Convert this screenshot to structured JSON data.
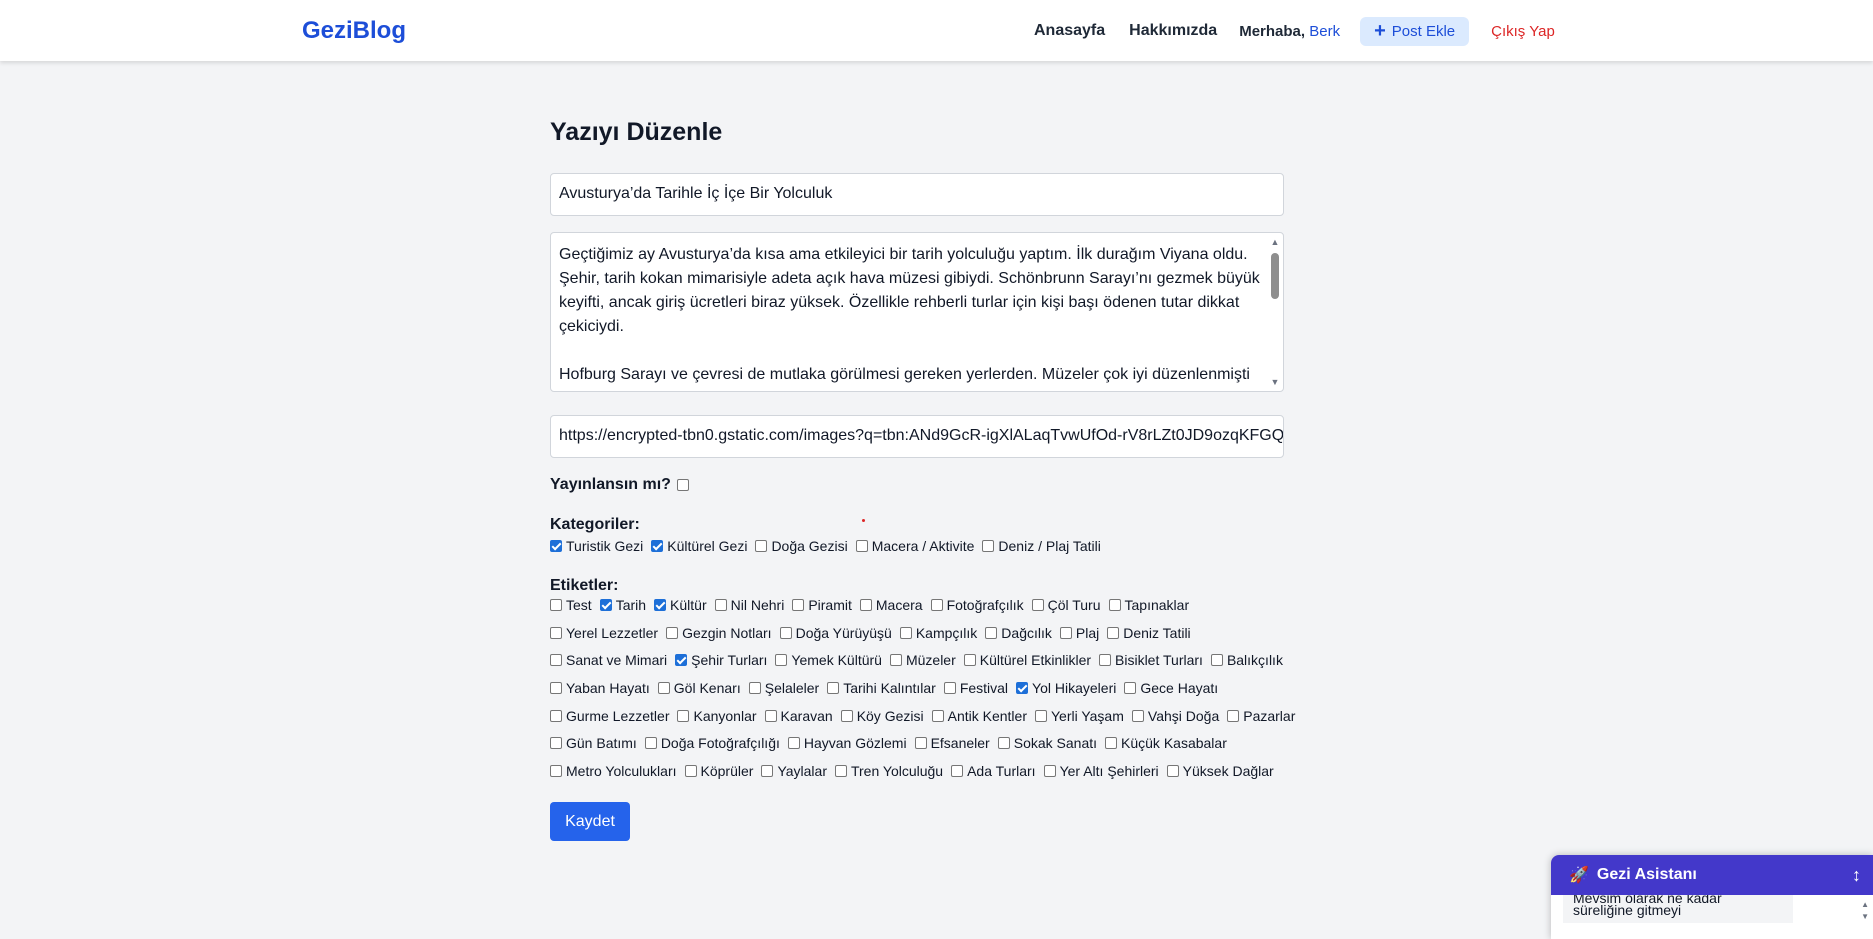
{
  "navbar": {
    "logo": "GeziBlog",
    "links": {
      "home": "Anasayfa",
      "about": "Hakkımızda"
    },
    "greeting": "Merhaba,",
    "username": "Berk",
    "add_post_icon": "plus-icon",
    "add_post": "Post Ekle",
    "logout": "Çıkış Yap",
    "colors": {
      "brand": "#1d4ed8",
      "logout": "#dc2626"
    }
  },
  "form": {
    "heading": "Yazıyı Düzenle",
    "title_value": "Avusturya’da Tarihle İç İçe Bir Yolculuk",
    "content_paragraphs": [
      "Geçtiğimiz ay Avusturya’da kısa ama etkileyici bir tarih yolculuğu yaptım. İlk durağım Viyana oldu. Şehir, tarih kokan mimarisiyle adeta açık hava müzesi gibiydi. Schönbrunn Sarayı’nı gezmek büyük keyifti, ancak giriş ücretleri biraz yüksek. Özellikle rehberli turlar için kişi başı ödenen tutar dikkat çekiciydi.",
      "Hofburg Sarayı ve çevresi de mutlaka görülmesi gereken yerlerden. Müzeler çok iyi düzenlenmişti"
    ],
    "image_url": "https://encrypted-tbn0.gstatic.com/images?q=tbn:ANd9GcR-igXlALaqTvwUfOd-rV8rLZt0JD9ozqKFGQ",
    "publish_label": "Yayınlansın mı?",
    "publish_checked": false,
    "categories_label": "Kategoriler:",
    "categories": [
      {
        "label": "Turistik Gezi",
        "checked": true
      },
      {
        "label": "Kültürel Gezi",
        "checked": true
      },
      {
        "label": "Doğa Gezisi",
        "checked": false
      },
      {
        "label": "Macera / Aktivite",
        "checked": false
      },
      {
        "label": "Deniz / Plaj Tatili",
        "checked": false
      }
    ],
    "tags_label": "Etiketler:",
    "tag_rows": [
      [
        {
          "label": "Test",
          "checked": false
        },
        {
          "label": "Tarih",
          "checked": true
        },
        {
          "label": "Kültür",
          "checked": true
        },
        {
          "label": "Nil Nehri",
          "checked": false
        },
        {
          "label": "Piramit",
          "checked": false
        },
        {
          "label": "Macera",
          "checked": false
        },
        {
          "label": "Fotoğrafçılık",
          "checked": false
        },
        {
          "label": "Çöl Turu",
          "checked": false
        },
        {
          "label": "Tapınaklar",
          "checked": false
        }
      ],
      [
        {
          "label": "Yerel Lezzetler",
          "checked": false
        },
        {
          "label": "Gezgin Notları",
          "checked": false
        },
        {
          "label": "Doğa Yürüyüşü",
          "checked": false
        },
        {
          "label": "Kampçılık",
          "checked": false
        },
        {
          "label": "Dağcılık",
          "checked": false
        },
        {
          "label": "Plaj",
          "checked": false
        },
        {
          "label": "Deniz Tatili",
          "checked": false
        }
      ],
      [
        {
          "label": "Sanat ve Mimari",
          "checked": false
        },
        {
          "label": "Şehir Turları",
          "checked": true
        },
        {
          "label": "Yemek Kültürü",
          "checked": false
        },
        {
          "label": "Müzeler",
          "checked": false
        },
        {
          "label": "Kültürel Etkinlikler",
          "checked": false
        },
        {
          "label": "Bisiklet Turları",
          "checked": false
        },
        {
          "label": "Balıkçılık",
          "checked": false
        }
      ],
      [
        {
          "label": "Yaban Hayatı",
          "checked": false
        },
        {
          "label": "Göl Kenarı",
          "checked": false
        },
        {
          "label": "Şelaleler",
          "checked": false
        },
        {
          "label": "Tarihi Kalıntılar",
          "checked": false
        },
        {
          "label": "Festival",
          "checked": false
        },
        {
          "label": "Yol Hikayeleri",
          "checked": true
        },
        {
          "label": "Gece Hayatı",
          "checked": false
        }
      ],
      [
        {
          "label": "Gurme Lezzetler",
          "checked": false
        },
        {
          "label": "Kanyonlar",
          "checked": false
        },
        {
          "label": "Karavan",
          "checked": false
        },
        {
          "label": "Köy Gezisi",
          "checked": false
        },
        {
          "label": "Antik Kentler",
          "checked": false
        },
        {
          "label": "Yerli Yaşam",
          "checked": false
        },
        {
          "label": "Vahşi Doğa",
          "checked": false
        },
        {
          "label": "Pazarlar",
          "checked": false
        }
      ],
      [
        {
          "label": "Gün Batımı",
          "checked": false
        },
        {
          "label": "Doğa Fotoğrafçılığı",
          "checked": false
        },
        {
          "label": "Hayvan Gözlemi",
          "checked": false
        },
        {
          "label": "Efsaneler",
          "checked": false
        },
        {
          "label": "Sokak Sanatı",
          "checked": false
        },
        {
          "label": "Küçük Kasabalar",
          "checked": false
        }
      ],
      [
        {
          "label": "Metro Yolculukları",
          "checked": false
        },
        {
          "label": "Köprüler",
          "checked": false
        },
        {
          "label": "Yaylalar",
          "checked": false
        },
        {
          "label": "Tren Yolculuğu",
          "checked": false
        },
        {
          "label": "Ada Turları",
          "checked": false
        },
        {
          "label": "Yer Altı Şehirleri",
          "checked": false
        },
        {
          "label": "Yüksek Dağlar",
          "checked": false
        }
      ]
    ],
    "save_button": "Kaydet",
    "colors": {
      "primary": "#2563eb",
      "checkbox_checked": "#1d6fd8"
    }
  },
  "chat_widget": {
    "icon": "rocket-icon",
    "title": "Gezi Asistanı",
    "resize_icon": "resize-vertical-icon",
    "message_partial_lines": [
      "Mevsim olarak ne kadar",
      "süreliğine gitmeyi"
    ],
    "color": "#4338ca"
  }
}
